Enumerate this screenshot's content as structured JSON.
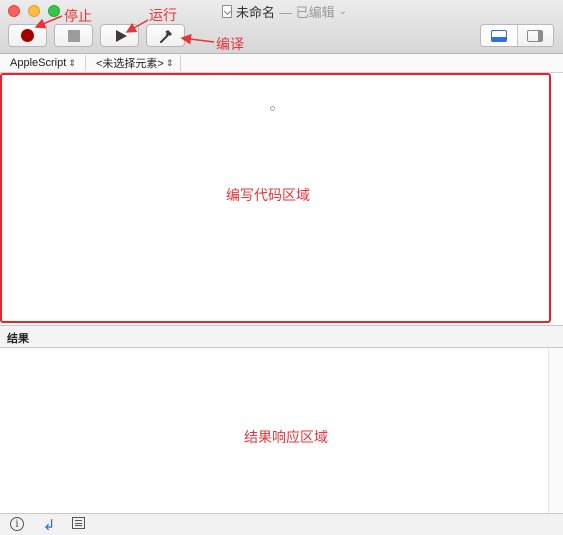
{
  "window": {
    "title": "未命名",
    "status": "— 已编辑",
    "chevron": "⌄"
  },
  "toolbar": {
    "annotations": {
      "stop": "停止",
      "run": "运行",
      "compile": "编译"
    },
    "annotation_color": "#e8343a"
  },
  "navbar": {
    "language": "AppleScript",
    "element": "<未选择元素>",
    "popup_arrow": "⌃"
  },
  "editor": {
    "region_label": "编写代码区域",
    "highlight_color": "#e8232c"
  },
  "results": {
    "header": "结果",
    "region_label": "结果响应区域"
  },
  "bottombar": {
    "info_icon": "i",
    "return_icon": "↲"
  }
}
